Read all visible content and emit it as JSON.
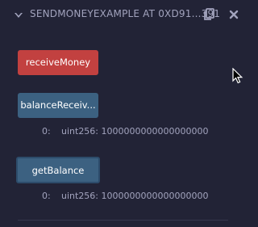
{
  "header": {
    "title": "SENDMONEYEXAMPLE AT 0XD91...391",
    "expand_icon": "chevron-down-icon",
    "copy_icon": "copy-icon",
    "close_icon": "close-icon"
  },
  "functions": [
    {
      "label": "receiveMoney",
      "kind": "payable",
      "color": "#c24140"
    },
    {
      "label": "balanceReceiv...",
      "kind": "call",
      "color": "#3c6181"
    },
    {
      "label": "getBalance",
      "kind": "call",
      "color": "#3c6181"
    }
  ],
  "outputs": [
    {
      "index": "0:",
      "value": "uint256: 1000000000000000000"
    },
    {
      "index": "0:",
      "value": "uint256: 1000000000000000000"
    }
  ],
  "colors": {
    "background": "#222336",
    "text_muted": "#a2a3bd",
    "payable": "#c24140",
    "call": "#3c6181"
  }
}
